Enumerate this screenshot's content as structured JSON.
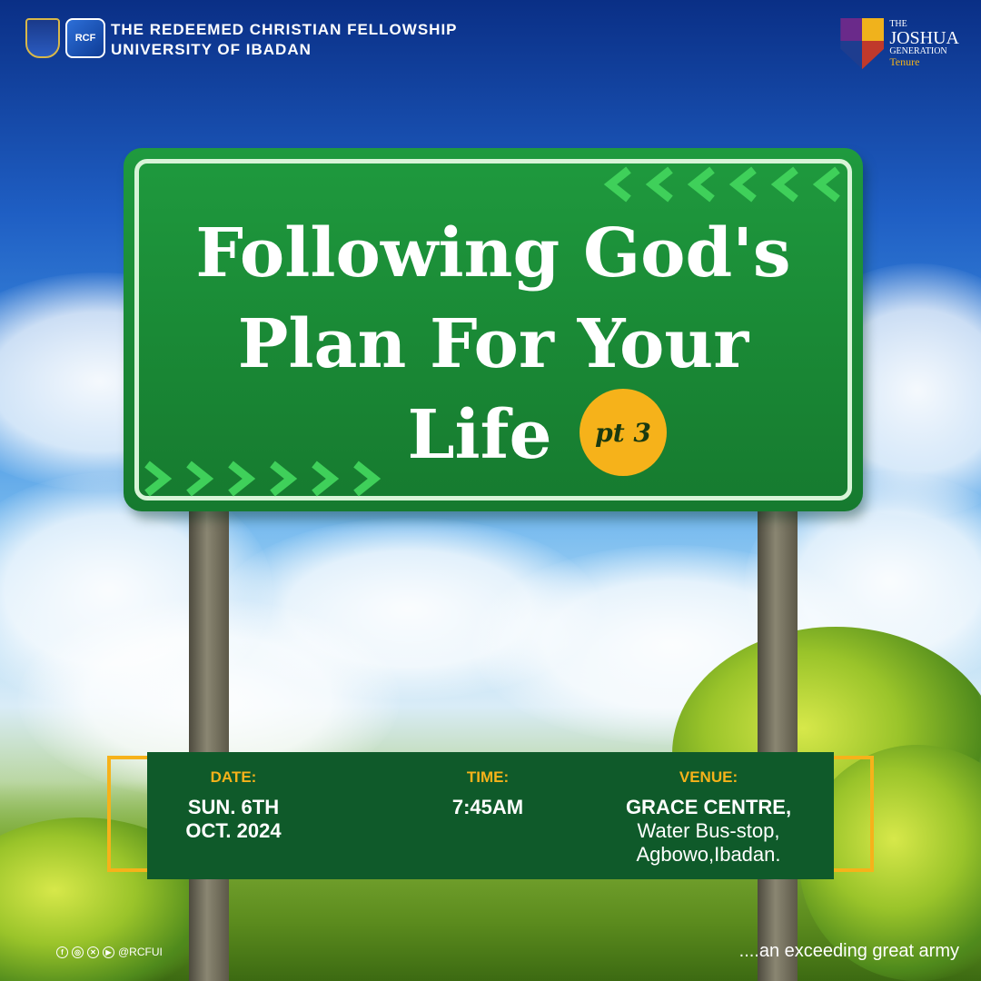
{
  "header": {
    "org_line1": "THE REDEEMED CHRISTIAN FELLOWSHIP",
    "org_line2": "UNIVERSITY OF IBADAN",
    "rcf_logo_text": "RCF",
    "partner": {
      "the": "THE",
      "name": "JOSHUA",
      "generation": "GENERATION",
      "tenure": "Tenure"
    }
  },
  "sign": {
    "title_line1": "Following God's",
    "title_line2": "Plan For Your",
    "title_line3": "Life",
    "part_badge": "pt 3"
  },
  "event": {
    "date_label": "DATE:",
    "date_line1": "SUN. 6TH",
    "date_line2": "OCT. 2024",
    "time_label": "TIME:",
    "time_value": "7:45AM",
    "venue_label": "VENUE:",
    "venue_name": "GRACE CENTRE,",
    "venue_line2": "Water Bus-stop,",
    "venue_line3": "Agbowo,Ibadan."
  },
  "footer": {
    "social_handle": "@RCFUI",
    "social_icons": [
      "facebook-icon",
      "instagram-icon",
      "x-icon",
      "youtube-icon"
    ],
    "tagline": "....an exceeding great army"
  },
  "colors": {
    "sign_green": "#1a8a36",
    "info_green": "#0f5a2a",
    "accent_yellow": "#f6b21a"
  }
}
